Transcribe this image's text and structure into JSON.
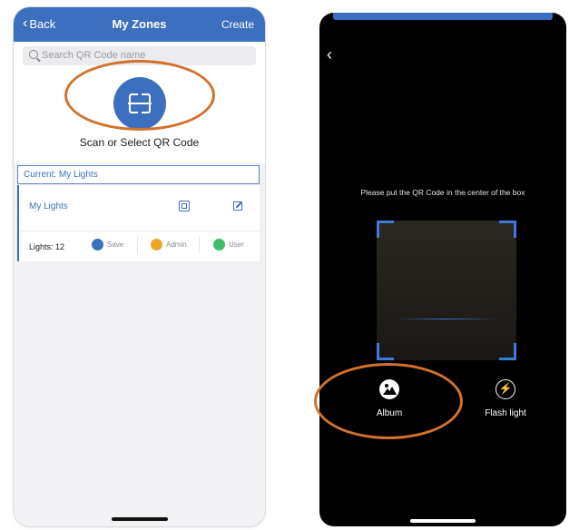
{
  "left_screen": {
    "nav": {
      "back_label": "Back",
      "title": "My Zones",
      "create_label": "Create"
    },
    "search": {
      "placeholder": "Search QR Code name"
    },
    "scan": {
      "label": "Scan or Select QR Code"
    },
    "current": {
      "label": "Current: My Lights"
    },
    "zone": {
      "name": "My Lights",
      "lights_label": "Lights: 12",
      "actions": [
        {
          "label": "Save",
          "color": "#3d6fc0"
        },
        {
          "label": "Admin",
          "color": "#f0a52a"
        },
        {
          "label": "User",
          "color": "#3fbf6c"
        }
      ]
    }
  },
  "right_screen": {
    "hint": "Please put the QR Code in the center of the box",
    "album_label": "Album",
    "flash_label": "Flash light"
  },
  "colors": {
    "accent": "#3d6fc0",
    "annotation": "#d2722c",
    "scan_frame": "#3d7bd8"
  }
}
